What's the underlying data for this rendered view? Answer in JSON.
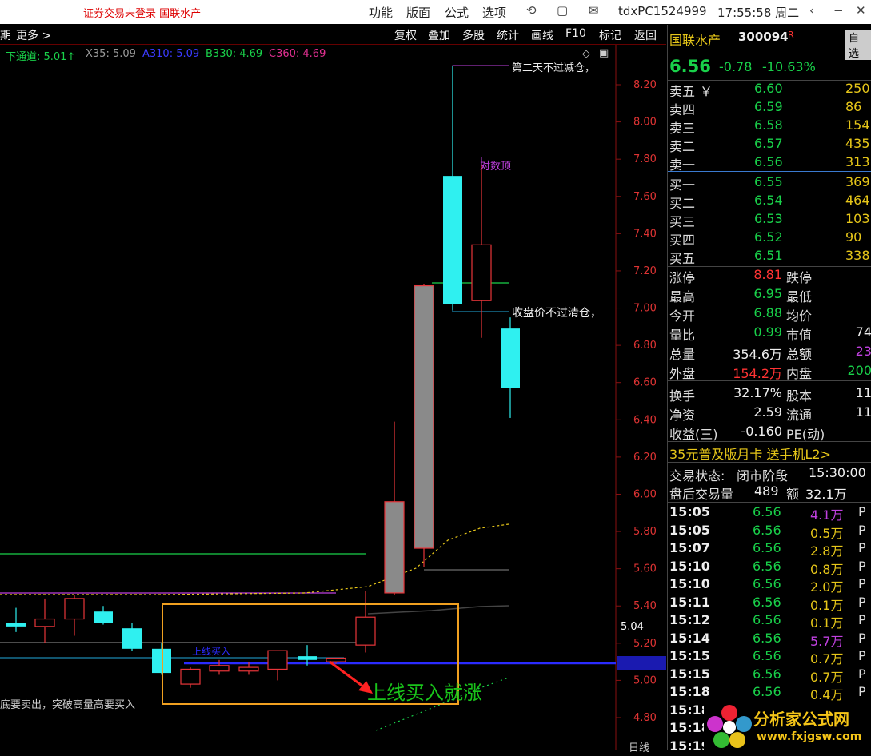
{
  "topbar": {
    "warning": "证券交易未登录  国联水产",
    "menus": [
      "功能",
      "版面",
      "公式",
      "选项"
    ],
    "user": "tdxPC1524999",
    "time": "17:55:58 周二"
  },
  "toolbar": {
    "left": [
      "期",
      "更多 >"
    ],
    "items": [
      "复权",
      "叠加",
      "多股",
      "统计",
      "画线",
      "F10",
      "标记",
      "返回"
    ]
  },
  "legend": [
    {
      "text": "下通道: 5.01↑",
      "color": "#19d14a"
    },
    {
      "text": "X35: 5.09",
      "color": "#9a9a9a"
    },
    {
      "text": "A310: 5.09",
      "color": "#3b3bff"
    },
    {
      "text": "B330: 4.69",
      "color": "#19d14a"
    },
    {
      "text": "C360: 4.69",
      "color": "#e03090"
    }
  ],
  "axis_ticks": [
    "8.20",
    "8.00",
    "7.80",
    "7.60",
    "7.40",
    "7.20",
    "7.00",
    "6.80",
    "6.60",
    "6.40",
    "6.20",
    "6.00",
    "5.80",
    "5.60",
    "5.40",
    "5.20",
    "5.00",
    "4.80"
  ],
  "price_tag": "5.04",
  "annotations": {
    "top": "第二天不过减仓，",
    "logtop": "对数顶",
    "close_rule": "收盘价不过清仓，",
    "buy_line": "上线买入",
    "bottom_left": "底要卖出，突破高量高要买入",
    "big": "上线买入就涨",
    "period": "日线"
  },
  "stock": {
    "name": "国联水产",
    "code": "300094",
    "flag": "R",
    "price": "6.56",
    "change": "-0.78",
    "pct": "-10.63%",
    "self": "自选"
  },
  "orderbook": [
    {
      "label": "卖五",
      "mark": "￥",
      "price": "6.60",
      "vol": "250"
    },
    {
      "label": "卖四",
      "mark": "",
      "price": "6.59",
      "vol": "86"
    },
    {
      "label": "卖三",
      "mark": "",
      "price": "6.58",
      "vol": "154"
    },
    {
      "label": "卖二",
      "mark": "",
      "price": "6.57",
      "vol": "435"
    },
    {
      "label": "卖一",
      "mark": "",
      "price": "6.56",
      "vol": "313"
    },
    {
      "label": "买一",
      "mark": "",
      "price": "6.55",
      "vol": "369"
    },
    {
      "label": "买二",
      "mark": "",
      "price": "6.54",
      "vol": "464"
    },
    {
      "label": "买三",
      "mark": "",
      "price": "6.53",
      "vol": "103"
    },
    {
      "label": "买四",
      "mark": "",
      "price": "6.52",
      "vol": "90"
    },
    {
      "label": "买五",
      "mark": "",
      "price": "6.51",
      "vol": "338"
    }
  ],
  "stats": [
    {
      "l1": "涨停",
      "v1": "8.81",
      "c1": "r",
      "l2": "跌停",
      "v2": ""
    },
    {
      "l1": "最高",
      "v1": "6.95",
      "c1": "g",
      "l2": "最低",
      "v2": ""
    },
    {
      "l1": "今开",
      "v1": "6.88",
      "c1": "g",
      "l2": "均价",
      "v2": ""
    },
    {
      "l1": "量比",
      "v1": "0.99",
      "c1": "g",
      "l2": "市值",
      "v2": "74"
    },
    {
      "l1": "总量",
      "v1": "354.6万",
      "c1": "w",
      "l2": "总额",
      "v2": "23"
    },
    {
      "l1": "外盘",
      "v1": "154.2万",
      "c1": "r",
      "l2": "内盘",
      "v2": "200"
    },
    {
      "l1": "换手",
      "v1": "32.17%",
      "c1": "w",
      "l2": "股本",
      "v2": "11"
    },
    {
      "l1": "净资",
      "v1": "2.59",
      "c1": "w",
      "l2": "流通",
      "v2": "11"
    },
    {
      "l1": "收益(三)",
      "v1": "-0.160",
      "c1": "w",
      "l2": "PE(动)",
      "v2": ""
    }
  ],
  "promo": "35元普及版月卡 送手机L2>",
  "trade_status": {
    "label": "交易状态:",
    "value": "闭市阶段",
    "time": "15:30:00"
  },
  "after_hours": {
    "label": "盘后交易量",
    "vol": "489",
    "amt_label": "额",
    "amt": "32.1万"
  },
  "ticks": [
    {
      "t": "15:05",
      "p": "6.56",
      "v": "4.1万",
      "c": "p"
    },
    {
      "t": "15:05",
      "p": "6.56",
      "v": "0.5万",
      "c": "y"
    },
    {
      "t": "15:07",
      "p": "6.56",
      "v": "2.8万",
      "c": "y"
    },
    {
      "t": "15:10",
      "p": "6.56",
      "v": "0.8万",
      "c": "y"
    },
    {
      "t": "15:10",
      "p": "6.56",
      "v": "2.0万",
      "c": "y"
    },
    {
      "t": "15:11",
      "p": "6.56",
      "v": "0.1万",
      "c": "y"
    },
    {
      "t": "15:12",
      "p": "6.56",
      "v": "0.1万",
      "c": "y"
    },
    {
      "t": "15:14",
      "p": "6.56",
      "v": "5.7万",
      "c": "p"
    },
    {
      "t": "15:15",
      "p": "6.56",
      "v": "0.7万",
      "c": "y"
    },
    {
      "t": "15:15",
      "p": "6.56",
      "v": "0.7万",
      "c": "y"
    },
    {
      "t": "15:18",
      "p": "6.56",
      "v": "0.4万",
      "c": "y"
    },
    {
      "t": "15:18",
      "p": "",
      "v": "",
      "c": "y"
    },
    {
      "t": "15:18",
      "p": "",
      "v": "",
      "c": "y"
    },
    {
      "t": "15:19",
      "p": "",
      "v": "",
      "c": "y"
    }
  ],
  "tick_side": "P",
  "watermark": {
    "cn": "分析家公式网",
    "url": "www.fxjgsw.com"
  },
  "chart_data": {
    "type": "candlestick",
    "ylim": [
      4.75,
      8.32
    ],
    "candles": [
      {
        "x": 20,
        "o": 5.29,
        "c": 5.31,
        "h": 5.39,
        "l": 5.26,
        "color": "cyan"
      },
      {
        "x": 56,
        "o": 5.29,
        "c": 5.33,
        "h": 5.44,
        "l": 5.2,
        "color": "red"
      },
      {
        "x": 93,
        "o": 5.33,
        "c": 5.44,
        "h": 5.46,
        "l": 5.24,
        "color": "red"
      },
      {
        "x": 129,
        "o": 5.37,
        "c": 5.31,
        "h": 5.4,
        "l": 5.3,
        "color": "cyan"
      },
      {
        "x": 165,
        "o": 5.28,
        "c": 5.17,
        "h": 5.31,
        "l": 5.16,
        "color": "cyan"
      },
      {
        "x": 202,
        "o": 5.17,
        "c": 5.04,
        "h": 5.2,
        "l": 5.03,
        "color": "cyan"
      },
      {
        "x": 238,
        "o": 4.98,
        "c": 5.06,
        "h": 5.07,
        "l": 4.96,
        "color": "red"
      },
      {
        "x": 274,
        "o": 5.05,
        "c": 5.08,
        "h": 5.11,
        "l": 5.03,
        "color": "red"
      },
      {
        "x": 311,
        "o": 5.05,
        "c": 5.07,
        "h": 5.1,
        "l": 5.03,
        "color": "red"
      },
      {
        "x": 347,
        "o": 5.06,
        "c": 5.16,
        "h": 5.16,
        "l": 5.0,
        "color": "red"
      },
      {
        "x": 384,
        "o": 5.13,
        "c": 5.11,
        "h": 5.19,
        "l": 5.08,
        "color": "cyan"
      },
      {
        "x": 420,
        "o": 5.1,
        "c": 5.12,
        "h": 5.12,
        "l": 5.09,
        "color": "red"
      },
      {
        "x": 457,
        "o": 5.19,
        "c": 5.34,
        "h": 5.48,
        "l": 5.15,
        "color": "red"
      },
      {
        "x": 493,
        "o": 5.47,
        "c": 5.96,
        "h": 6.39,
        "l": 5.46,
        "color": "gray"
      },
      {
        "x": 530,
        "o": 5.71,
        "c": 7.12,
        "h": 7.13,
        "l": 5.61,
        "color": "gray"
      },
      {
        "x": 566,
        "o": 7.71,
        "c": 7.02,
        "h": 8.3,
        "l": 6.99,
        "color": "cyan"
      },
      {
        "x": 602,
        "o": 7.04,
        "c": 7.34,
        "h": 7.77,
        "l": 6.84,
        "color": "red"
      },
      {
        "x": 638,
        "o": 6.89,
        "c": 6.57,
        "h": 6.95,
        "l": 6.41,
        "color": "cyan"
      }
    ]
  }
}
